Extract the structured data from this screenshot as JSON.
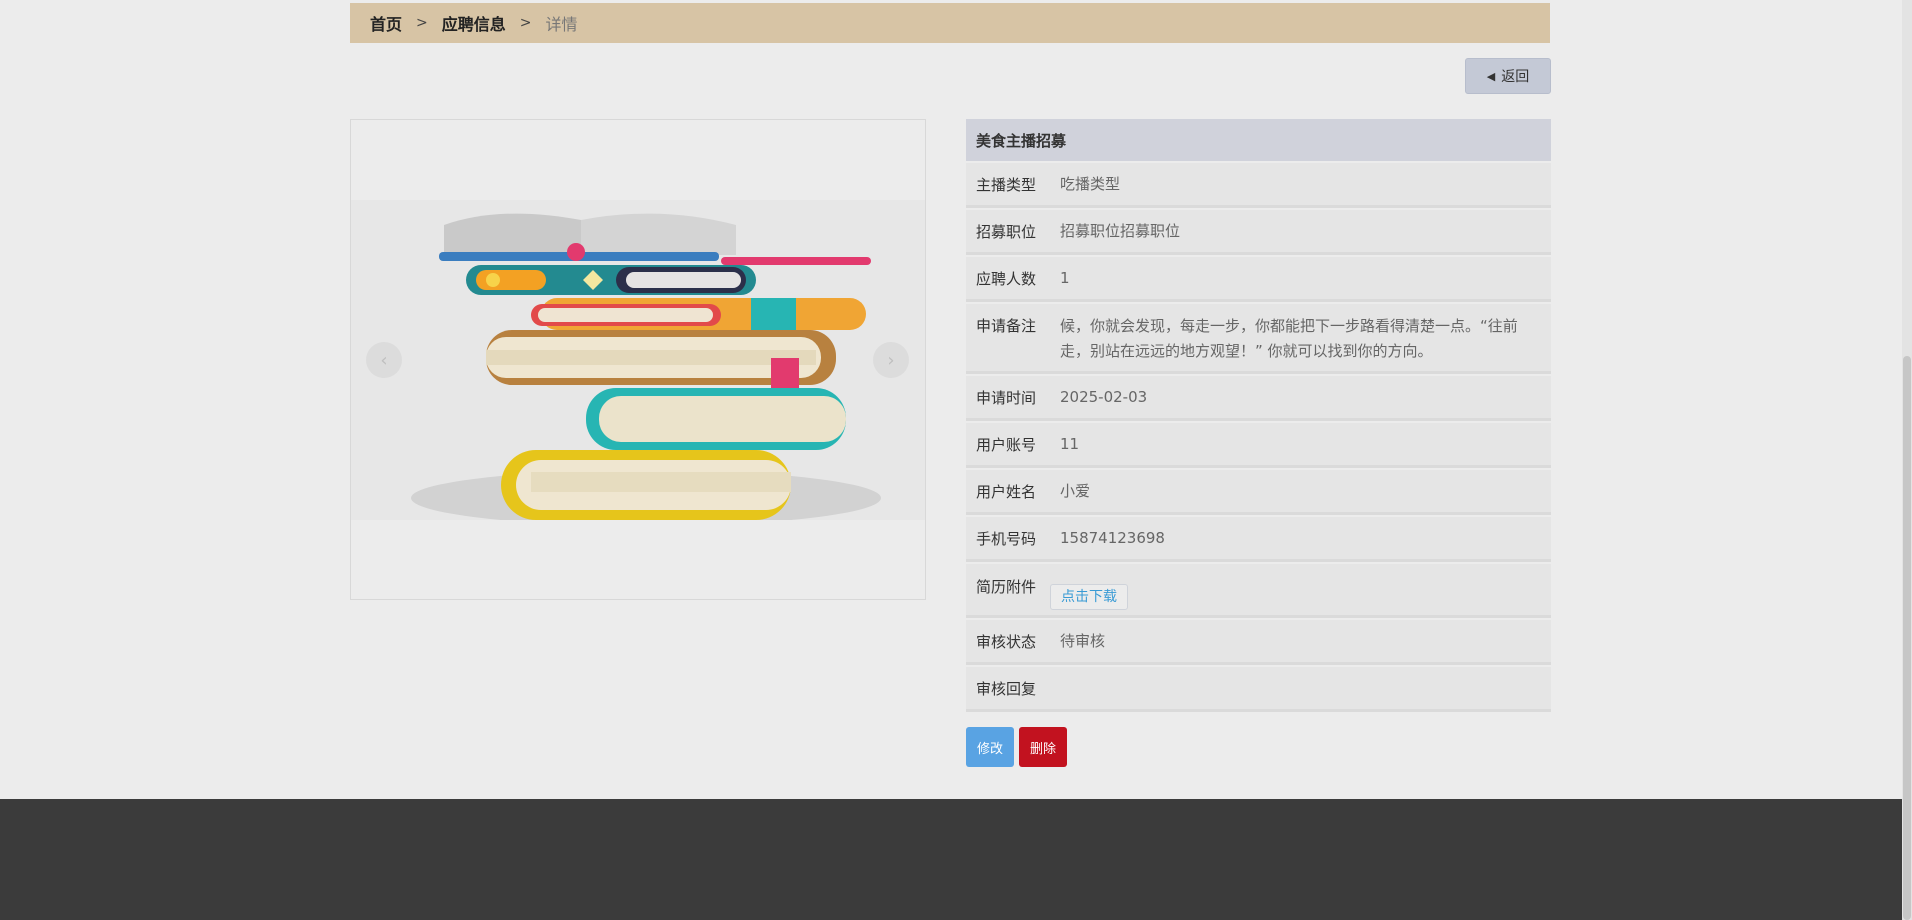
{
  "breadcrumb": {
    "home": "首页",
    "separator": ">",
    "section": "应聘信息",
    "current": "详情"
  },
  "back_button": {
    "label": "返回",
    "icon": "caret-left-icon"
  },
  "gallery": {
    "image": "stacked-books-illustration",
    "prev_icon": "‹",
    "next_icon": "›"
  },
  "detail": {
    "title": "美食主播招募",
    "fields": [
      {
        "label": "主播类型",
        "value": "吃播类型"
      },
      {
        "label": "招募职位",
        "value": "招募职位招募职位"
      },
      {
        "label": "应聘人数",
        "value": "1"
      },
      {
        "label": "申请备注",
        "value": "候，你就会发现，每走一步，你都能把下一步路看得清楚一点。“往前走，别站在远远的地方观望！” 你就可以找到你的方向。"
      },
      {
        "label": "申请时间",
        "value": "2025-02-03"
      },
      {
        "label": "用户账号",
        "value": "11"
      },
      {
        "label": "用户姓名",
        "value": "小爱"
      },
      {
        "label": "手机号码",
        "value": "15874123698"
      },
      {
        "label": "简历附件",
        "action": "点击下载"
      },
      {
        "label": "审核状态",
        "value": "待审核"
      },
      {
        "label": "审核回复",
        "value": ""
      }
    ]
  },
  "actions": {
    "edit": "修改",
    "delete": "删除"
  },
  "colors": {
    "breadcrumb_bg": "#d7c4a5",
    "edit_button": "#59a3e3",
    "delete_button": "#c2121f",
    "footer": "#3b3b3b"
  }
}
